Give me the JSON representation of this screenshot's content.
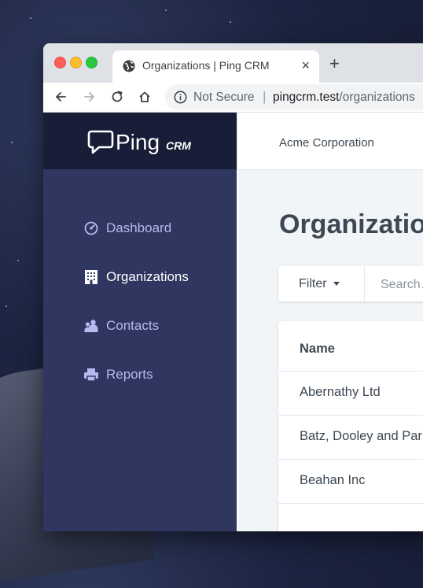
{
  "browser": {
    "tab_title": "Organizations | Ping CRM",
    "tab_close": "×",
    "new_tab": "+",
    "security_label": "Not Secure",
    "url_host": "pingcrm.test",
    "url_path": "/organizations"
  },
  "app": {
    "logo_text": "Ping",
    "logo_suffix": "CRM",
    "account_name": "Acme Corporation"
  },
  "sidebar": {
    "items": [
      {
        "label": "Dashboard",
        "icon": "dashboard-icon",
        "active": false
      },
      {
        "label": "Organizations",
        "icon": "building-icon",
        "active": true
      },
      {
        "label": "Contacts",
        "icon": "users-icon",
        "active": false
      },
      {
        "label": "Reports",
        "icon": "printer-icon",
        "active": false
      }
    ]
  },
  "main": {
    "title": "Organizations",
    "filter_label": "Filter",
    "search_placeholder": "Search…",
    "table": {
      "columns": [
        "Name"
      ],
      "rows": [
        "Abernathy Ltd",
        "Batz, Dooley and Parisian",
        "Beahan Inc",
        ""
      ]
    }
  },
  "colors": {
    "sidebar_top": "#191e38",
    "sidebar": "#2f365f",
    "sidebar_link": "#b4bbf0",
    "main_bg": "#f1f5f8",
    "text": "#3d4852"
  }
}
